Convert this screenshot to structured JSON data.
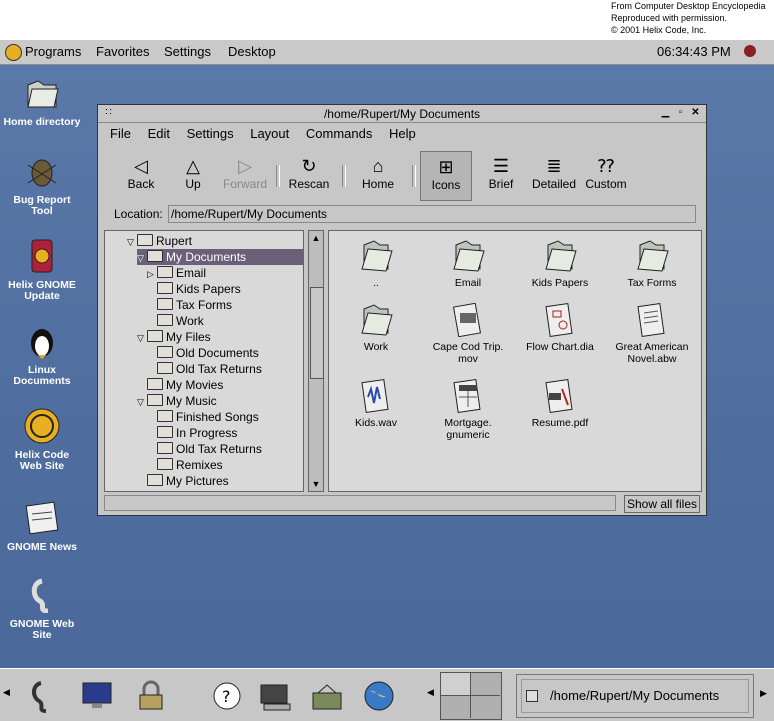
{
  "credit": {
    "line1": "From Computer Desktop Encyclopedia",
    "line2": "Reproduced with permission.",
    "line3": "© 2001 Helix Code, Inc."
  },
  "topbar": {
    "menus": [
      "Programs",
      "Favorites",
      "Settings",
      "Desktop"
    ],
    "clock": "06:34:43 PM"
  },
  "desktop_icons": [
    {
      "label1": "Home directory",
      "label2": "",
      "icon": "home-folder-icon"
    },
    {
      "label1": "Bug Report",
      "label2": "Tool",
      "icon": "bug-icon"
    },
    {
      "label1": "Helix GNOME",
      "label2": "Update",
      "icon": "update-can-icon"
    },
    {
      "label1": "Linux",
      "label2": "Documents",
      "icon": "penguin-icon"
    },
    {
      "label1": "Helix Code",
      "label2": "Web Site",
      "icon": "helix-web-icon"
    },
    {
      "label1": "GNOME News",
      "label2": "",
      "icon": "newspaper-icon"
    },
    {
      "label1": "GNOME Web",
      "label2": "Site",
      "icon": "gnome-foot-icon"
    }
  ],
  "window": {
    "title": "/home/Rupert/My Documents",
    "menus": [
      "File",
      "Edit",
      "Settings",
      "Layout",
      "Commands",
      "Help"
    ],
    "toolbar": {
      "back": "Back",
      "up": "Up",
      "forward": "Forward",
      "rescan": "Rescan",
      "home": "Home",
      "icons": "Icons",
      "brief": "Brief",
      "detailed": "Detailed",
      "custom": "Custom"
    },
    "location_label": "Location:",
    "location_value": "/home/Rupert/My Documents",
    "tree": [
      {
        "label": "Rupert",
        "indent": 0,
        "expander": "open",
        "selected": false
      },
      {
        "label": "My Documents",
        "indent": 1,
        "expander": "open",
        "selected": true
      },
      {
        "label": "Email",
        "indent": 2,
        "expander": "closed",
        "selected": false
      },
      {
        "label": "Kids Papers",
        "indent": 2,
        "expander": "none",
        "selected": false
      },
      {
        "label": "Tax Forms",
        "indent": 2,
        "expander": "none",
        "selected": false
      },
      {
        "label": "Work",
        "indent": 2,
        "expander": "none",
        "selected": false
      },
      {
        "label": "My Files",
        "indent": 1,
        "expander": "open",
        "selected": false
      },
      {
        "label": "Old Documents",
        "indent": 2,
        "expander": "none",
        "selected": false
      },
      {
        "label": "Old Tax Returns",
        "indent": 2,
        "expander": "none",
        "selected": false
      },
      {
        "label": "My Movies",
        "indent": 1,
        "expander": "none",
        "selected": false
      },
      {
        "label": "My Music",
        "indent": 1,
        "expander": "open",
        "selected": false
      },
      {
        "label": "Finished Songs",
        "indent": 2,
        "expander": "none",
        "selected": false
      },
      {
        "label": "In Progress",
        "indent": 2,
        "expander": "none",
        "selected": false
      },
      {
        "label": "Old Tax Returns",
        "indent": 2,
        "expander": "none",
        "selected": false
      },
      {
        "label": "Remixes",
        "indent": 2,
        "expander": "none",
        "selected": false
      },
      {
        "label": "My Pictures",
        "indent": 1,
        "expander": "none",
        "selected": false
      }
    ],
    "files": [
      {
        "l1": "..",
        "l2": "",
        "icon": "folder-icon"
      },
      {
        "l1": "Email",
        "l2": "",
        "icon": "folder-icon"
      },
      {
        "l1": "Kids Papers",
        "l2": "",
        "icon": "folder-icon"
      },
      {
        "l1": "Tax Forms",
        "l2": "",
        "icon": "folder-icon"
      },
      {
        "l1": "Work",
        "l2": "",
        "icon": "folder-icon"
      },
      {
        "l1": "Cape Cod Trip.",
        "l2": "mov",
        "icon": "movie-file-icon"
      },
      {
        "l1": "Flow Chart.dia",
        "l2": "",
        "icon": "dia-file-icon"
      },
      {
        "l1": "Great American",
        "l2": "Novel.abw",
        "icon": "document-file-icon"
      },
      {
        "l1": "Kids.wav",
        "l2": "",
        "icon": "audio-file-icon"
      },
      {
        "l1": "Mortgage.",
        "l2": "gnumeric",
        "icon": "spreadsheet-file-icon"
      },
      {
        "l1": "Resume.pdf",
        "l2": "",
        "icon": "pdf-file-icon"
      }
    ],
    "show_all": "Show all files"
  },
  "panel": {
    "task_title": "/home/Rupert/My Documents"
  }
}
